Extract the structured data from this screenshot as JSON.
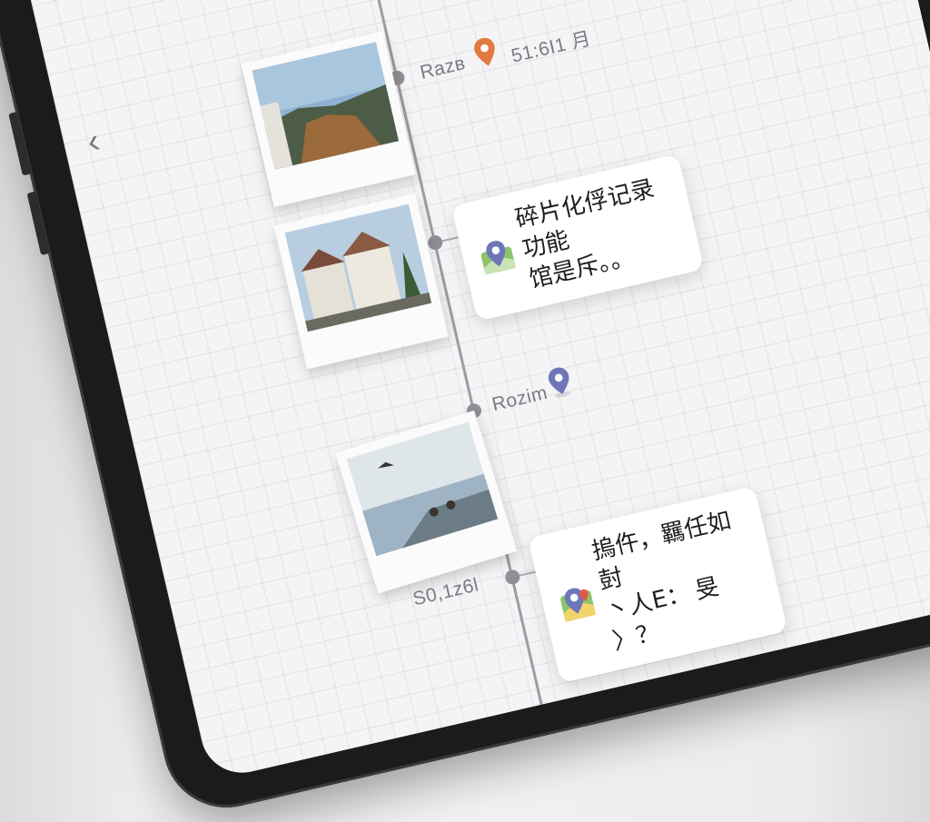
{
  "nav": {
    "back_glyph": "‹"
  },
  "timeline": {
    "entries": [
      {
        "label": "Razв",
        "time": "51:6I1 ⽉",
        "pin_color": "#e07a3f",
        "icon": "map-pin-orange-icon"
      },
      {
        "note": "碎片化俘记录功能\n馆是斥。。",
        "icon": "map-card-icon"
      },
      {
        "label": "Rozim",
        "pin_color": "#6e76b8",
        "icon": "map-pin-blue-icon"
      },
      {
        "time": "S0,1z6l",
        "note": "摀仵，羈任如尌\n丶人E： 旻 〉？",
        "icon": "map-card-icon"
      }
    ]
  },
  "colors": {
    "pin_orange": "#e07a3f",
    "pin_blue": "#6e76b8",
    "map_green": "#8cc46b"
  }
}
